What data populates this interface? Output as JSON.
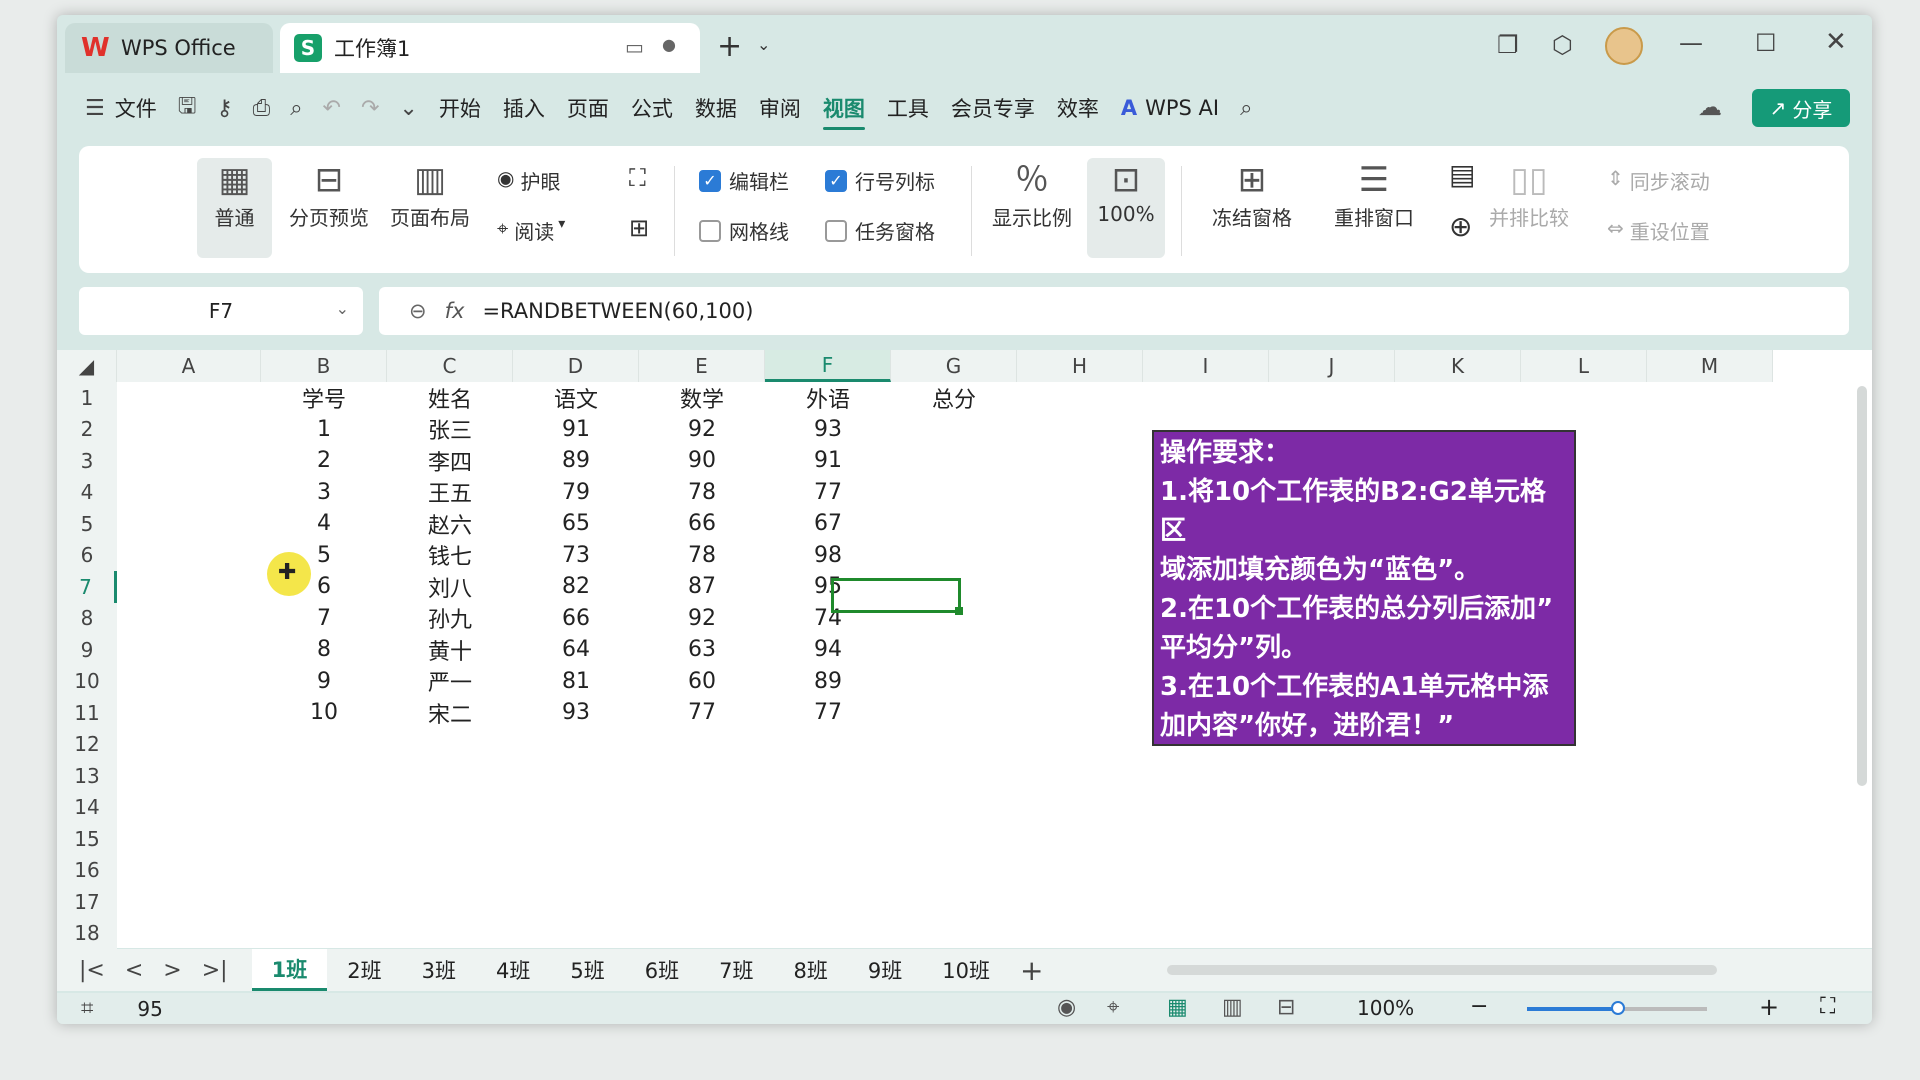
{
  "window": {
    "app_tab": "WPS Office",
    "doc_tab": "工作簿1"
  },
  "menu": {
    "file": "文件",
    "items": [
      "开始",
      "插入",
      "页面",
      "公式",
      "数据",
      "审阅",
      "视图",
      "工具",
      "会员专享",
      "效率"
    ],
    "wps_ai": "WPS AI",
    "share": "分享"
  },
  "ribbon": {
    "normal": "普通",
    "page_break": "分页预览",
    "page_layout": "页面布局",
    "eye_protect": "护眼",
    "reading": "阅读",
    "formula_bar": "编辑栏",
    "headings": "行号列标",
    "gridlines": "网格线",
    "task_pane": "任务窗格",
    "zoom": "显示比例",
    "zoom100": "100%",
    "freeze": "冻结窗格",
    "arrange": "重排窗口",
    "side_by_side": "并排比较",
    "sync_scroll": "同步滚动",
    "reset_pos": "重设位置"
  },
  "formula": {
    "cell": "F7",
    "fx": "fx",
    "value": "=RANDBETWEEN(60,100)"
  },
  "columns": [
    "A",
    "B",
    "C",
    "D",
    "E",
    "F",
    "G",
    "H",
    "I",
    "J",
    "K",
    "L",
    "M"
  ],
  "rows": [
    "1",
    "2",
    "3",
    "4",
    "5",
    "6",
    "7",
    "8",
    "9",
    "10",
    "11",
    "12",
    "13",
    "14",
    "15",
    "16",
    "17",
    "18"
  ],
  "table": {
    "headers": [
      "学号",
      "姓名",
      "语文",
      "数学",
      "外语",
      "总分"
    ],
    "data": [
      [
        "1",
        "张三",
        "91",
        "92",
        "93"
      ],
      [
        "2",
        "李四",
        "89",
        "90",
        "91"
      ],
      [
        "3",
        "王五",
        "79",
        "78",
        "77"
      ],
      [
        "4",
        "赵六",
        "65",
        "66",
        "67"
      ],
      [
        "5",
        "钱七",
        "73",
        "78",
        "98"
      ],
      [
        "6",
        "刘八",
        "82",
        "87",
        "95"
      ],
      [
        "7",
        "孙九",
        "66",
        "92",
        "74"
      ],
      [
        "8",
        "黄十",
        "64",
        "63",
        "94"
      ],
      [
        "9",
        "严一",
        "81",
        "60",
        "89"
      ],
      [
        "10",
        "宋二",
        "93",
        "77",
        "77"
      ]
    ]
  },
  "note": {
    "title": "操作要求：",
    "l1": "1.将10个工作表的B2:G2单元格区",
    "l2": "域添加填充颜色为“蓝色”。",
    "l3": "2.在10个工作表的总分列后添加”",
    "l4": "平均分”列。",
    "l5": "3.在10个工作表的A1单元格中添",
    "l6": "加内容”你好，进阶君！”"
  },
  "sheets": [
    "1班",
    "2班",
    "3班",
    "4班",
    "5班",
    "6班",
    "7班",
    "8班",
    "9班",
    "10班"
  ],
  "status": {
    "value": "95",
    "zoom": "100%"
  }
}
